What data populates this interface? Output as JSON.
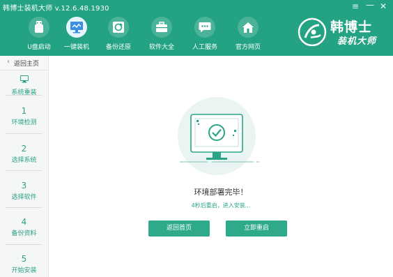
{
  "window": {
    "title": "韩博士装机大师 v.12.6.48.1930",
    "controls": {
      "menu": "≡",
      "minimize": "—",
      "close": "✕"
    }
  },
  "nav": {
    "items": [
      {
        "label": "U盘启动",
        "icon": "usb-icon"
      },
      {
        "label": "一键装机",
        "icon": "monitor-icon",
        "active": true
      },
      {
        "label": "备份还原",
        "icon": "restore-icon"
      },
      {
        "label": "软件大全",
        "icon": "briefcase-icon"
      },
      {
        "label": "人工服务",
        "icon": "chat-icon"
      },
      {
        "label": "官方网页",
        "icon": "home-icon"
      }
    ]
  },
  "brand": {
    "line1": "韩博士",
    "line2": "装机大师"
  },
  "sidebar": {
    "back_label": "返回主页",
    "steps": [
      {
        "label": "系统重装"
      },
      {
        "number": "1",
        "label": "环境检测"
      },
      {
        "number": "2",
        "label": "选择系统"
      },
      {
        "number": "3",
        "label": "选择软件"
      },
      {
        "number": "4",
        "label": "备份资料"
      },
      {
        "number": "5",
        "label": "开始安装"
      }
    ]
  },
  "main": {
    "status_title": "环境部署完毕！",
    "countdown_text": "4秒后重启，进入安装...",
    "buttons": {
      "home": "返回首页",
      "restart": "立即重启"
    }
  },
  "colors": {
    "header": "#23a383",
    "accent": "#2aa387",
    "button": "#2eaa8a"
  }
}
